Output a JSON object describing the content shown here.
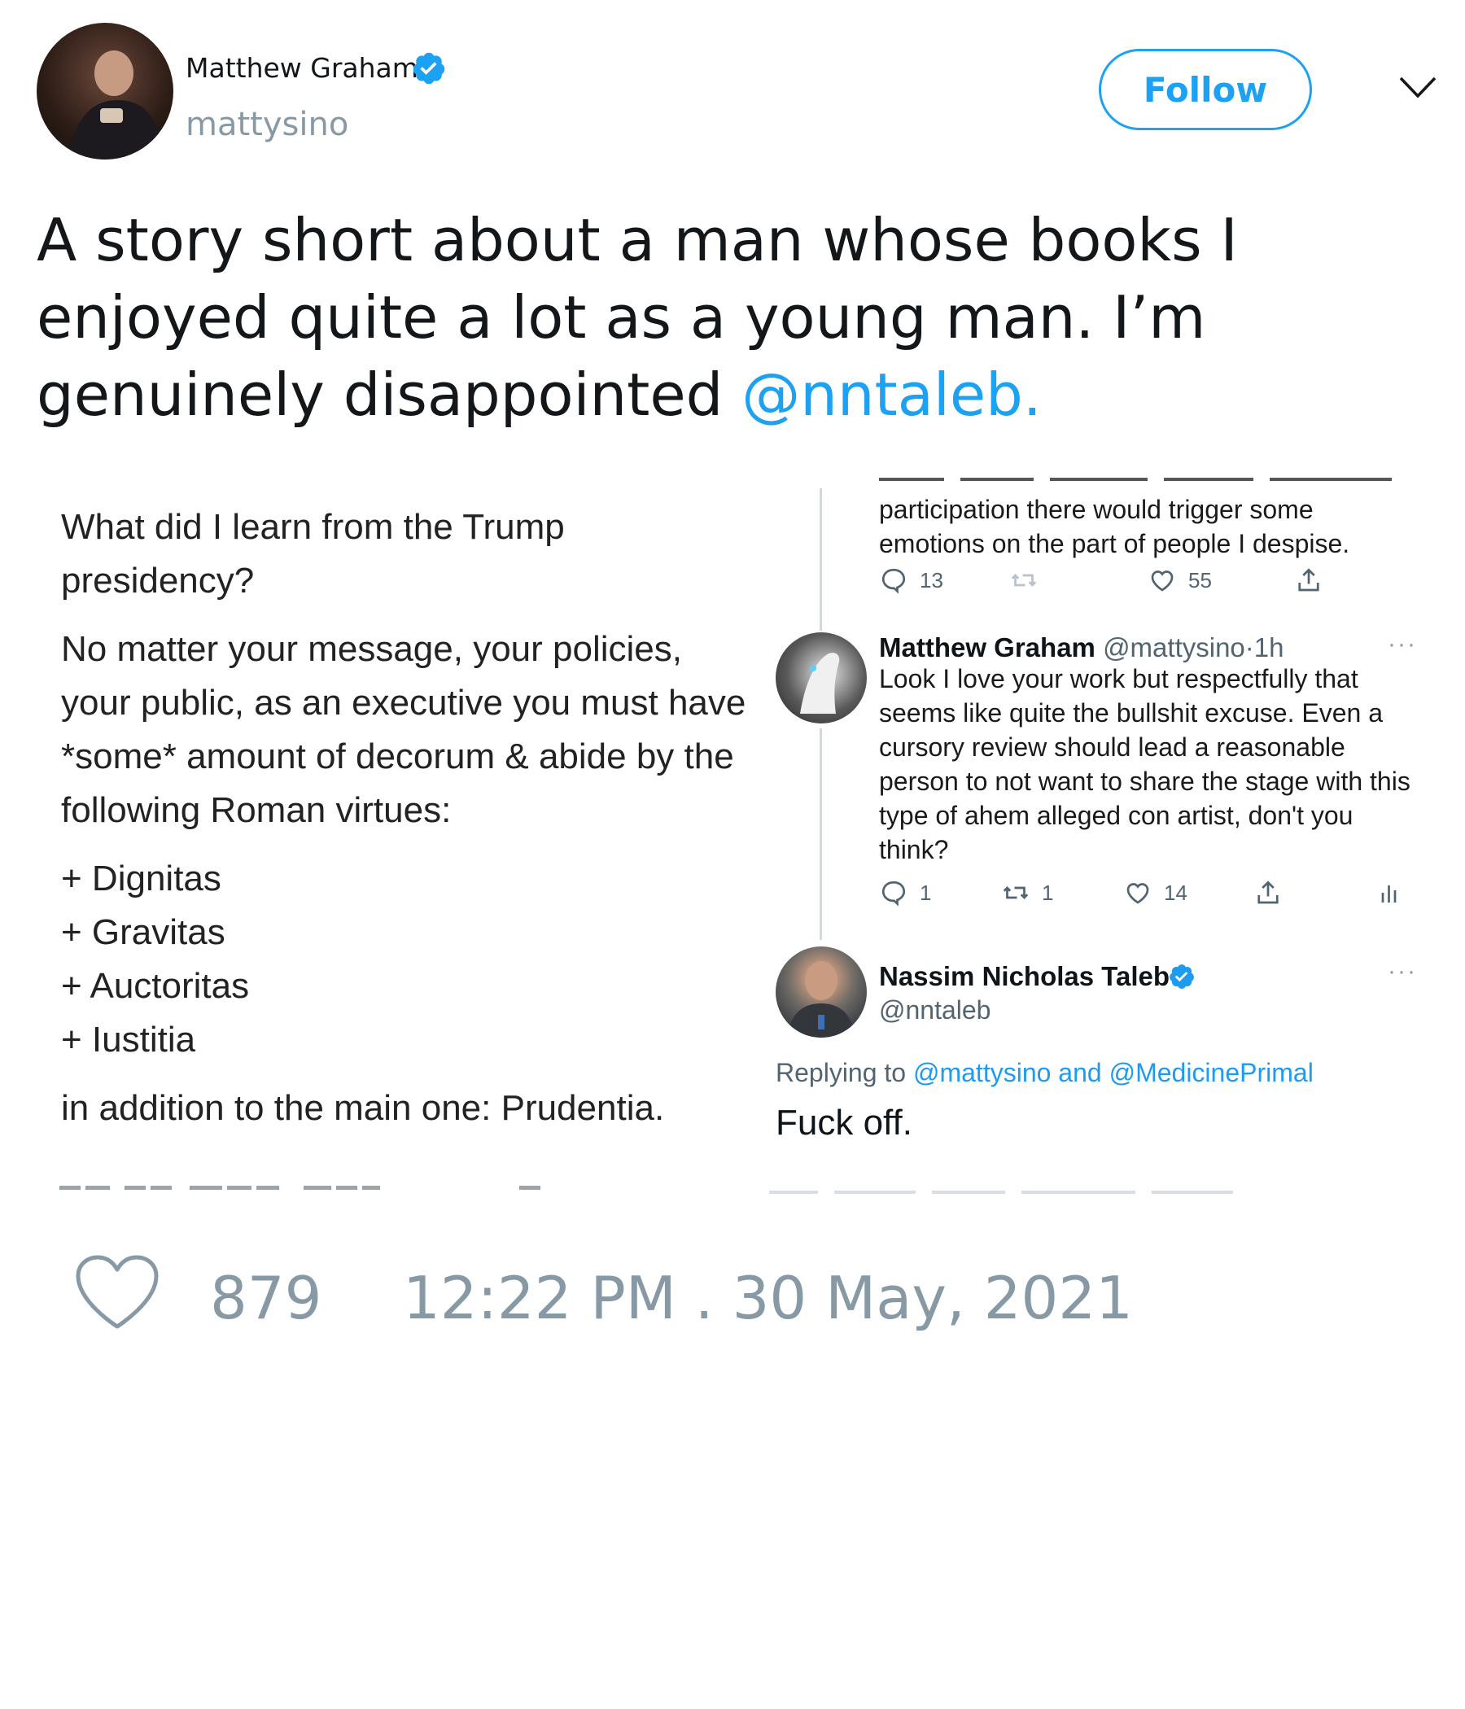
{
  "tweet": {
    "author": {
      "display_name": "Matthew Graham",
      "handle": "mattysino",
      "verified": true
    },
    "follow_label": "Follow",
    "text_before_mention": "A story short about a man whose books I enjoyed quite a lot as a young man. I’m genuinely disappointed ",
    "mention": "@nntaleb.",
    "likes": "879",
    "timestamp": "12:22 PM . 30 May, 2021",
    "colors": {
      "accent": "#1da1f2",
      "muted": "#8899a6",
      "text": "#14171a"
    }
  },
  "embedded": {
    "left_post": {
      "question": "What did I learn from the Trump presidency?",
      "paragraph": "No matter your message, your policies, your public, as an executive you must have *some* amount of decorum & abide by the following Roman virtues:",
      "virtues": [
        "+ Dignitas",
        "+ Gravitas",
        "+ Auctoritas",
        "+ Iustitia"
      ],
      "closing": "in addition to the main one: Prudentia."
    },
    "previous_reply": {
      "text": "participation there would trigger some emotions on the part of people I despise.",
      "replies": "13",
      "likes": "55"
    },
    "mg_reply": {
      "name": "Matthew Graham",
      "handle": "@mattysino",
      "dot": "·",
      "time": "1h",
      "more": "···",
      "text": "Look I love your work but respectfully that seems like quite the bullshit excuse. Even a cursory review should lead a reasonable person to not want to share the stage with this type of ahem alleged con artist, don't you think?",
      "replies": "1",
      "retweets": "1",
      "likes": "14"
    },
    "nnt_reply": {
      "name": "Nassim Nicholas Taleb",
      "handle": "@nntaleb",
      "more": "···",
      "replying_prefix": "Replying to ",
      "replying_user1": "@mattysino",
      "replying_and": " and ",
      "replying_user2": "@MedicinePrimal",
      "text": "Fuck off."
    }
  },
  "icons": {
    "verified": "verified-badge-icon",
    "caret": "chevron-down-icon",
    "like": "heart-icon",
    "reply": "reply-icon",
    "retweet": "retweet-icon",
    "share": "share-icon",
    "analytics": "analytics-icon"
  }
}
